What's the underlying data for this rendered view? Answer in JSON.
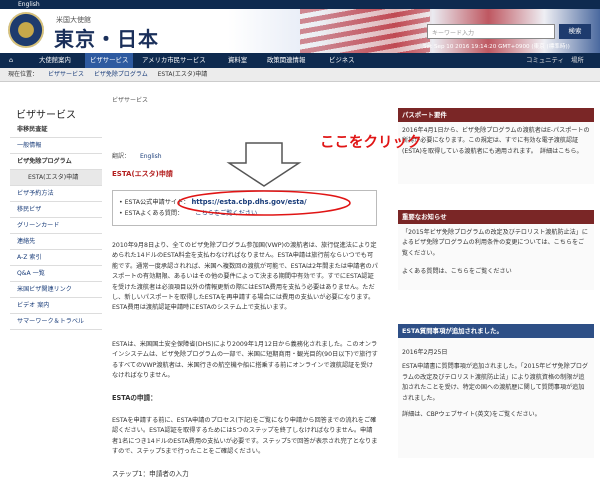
{
  "topbar": {
    "english": "English"
  },
  "header": {
    "embassy_small": "米国大使館",
    "embassy_big": "東京・日本",
    "search_placeholder": "キーワード入力",
    "search_button": "検索",
    "datetime": "Sat Sep 10 2016 19:14:20 GMT+0900 (東京 (標準時))"
  },
  "nav": {
    "items": [
      "大使館案内",
      "ビザサービス",
      "アメリカ市民サービス",
      "資料室",
      "政策関連情報",
      "ビジネス"
    ],
    "right": [
      "コミュニティ",
      "場所"
    ]
  },
  "breadcrumb": [
    "現在位置：",
    "ビザサービス",
    "ビザ免除プログラム",
    "ESTA(エスタ)申請"
  ],
  "sidebar": {
    "title": "ビザサービス",
    "items": [
      "非移民査証",
      "一般情報",
      "ビザ免除プログラム",
      "ESTA(エスタ)申請",
      "ビザ予約方法",
      "移民ビザ",
      "グリーンカード",
      "連絡先",
      "A-Z 索引",
      "Q&A 一覧",
      "米国ビザ関連リンク",
      "ビデオ 案内",
      "サマーワーク＆トラベル"
    ]
  },
  "main": {
    "crumb": "ビザサービス",
    "lang_label": "翻訳：",
    "lang_value": "English",
    "heading": "ESTA(エスタ)申請",
    "box_row1_label": "ESTA公式申請サイト：",
    "box_link": "https://esta.cbp.dhs.gov/esta/",
    "box_row2_label": "ESTAよくある質問：",
    "box_row2_link": "こちらをご覧ください",
    "para1": "2010年9月8日より、全てのビザ免除プログラム参加国(VWP)の渡航者は、旅行促進法により定められた14ドルのESTA料金を支払わなければなりません。ESTA申請は旅行前ならいつでも可能です。通常一度承認されれば、米国へ複数回の渡航が可能で、ESTAは2年間または申請者のパスポートの有効期限、あるいはその他の要件によって決まる期間中有効です。すでにESTA認証を受けた渡航者は必須項目以外の情報更新の際にはESTA費用を支払う必要はありません。ただし、新しいパスポートを取得したESTAを再申請する場合には費用の支払いが必要になります。ESTA費用は渡航認証申請時にESTAのシステム上で支払います。",
    "para2": "ESTAは、米国国土安全保障省(DHS)により2009年1月12日から義務化されました。このオンラインシステムは、ビザ免除プログラムの一部で、米国に短期商用・観光目的(90日以下)で旅行するすべてのVWP渡航者は、米国行きの航空機や船に搭乗する前にオンラインで渡航認証を受けなければなりません。",
    "subheading": "ESTAの申請：",
    "para3": "ESTAを申請する前に、ESTA申請のプロセス(下記)をご覧になり申請から回答までの流れをご確認ください。ESTA認証を取得するためには5つのステップを終了しなければなりません。申請者1名につき14ドルのESTA費用の支払いが必要です。ステップ5で回答が表示され完了となりますので、ステップ5まで行ったことをご確認ください。",
    "step_partial": "ステップ1：申請者の入力"
  },
  "right": {
    "panel1_head": "パスポート要件",
    "panel1_body": "2016年4月1日から、ビザ免除プログラムの渡航者はE-パスポートの所持が必要になります。この規定は、すでに有効な電子渡航認証(ESTA)を取得している渡航者にも適用されます。　詳細はこちら。",
    "panel2_head": "重要なお知らせ",
    "panel2_body": "「2015年ビザ免除プログラムの改定及びテロリスト渡航防止法」によるビザ免除プログラムの利用条件の変更については、こちらをご覧ください。",
    "panel2_faq": "よくある質問は、こちらをご覧ください",
    "panel3_head": "ESTA質問事項が追加されました。",
    "panel3_date": "2016年2月25日",
    "panel3_body": "ESTA申請書に質問事項が追加されました。「2015年ビザ免除プログラムの改定及びテロリスト渡航防止法」により渡航資格の制限が追加されたことを受け、特定の国への渡航歴に関して質問事項が追加されました。",
    "panel3_more": "詳細は、CBPウェブサイト(英文)をご覧ください。"
  },
  "annotation": {
    "text": "ここをクリック",
    "color": "#e01515"
  }
}
